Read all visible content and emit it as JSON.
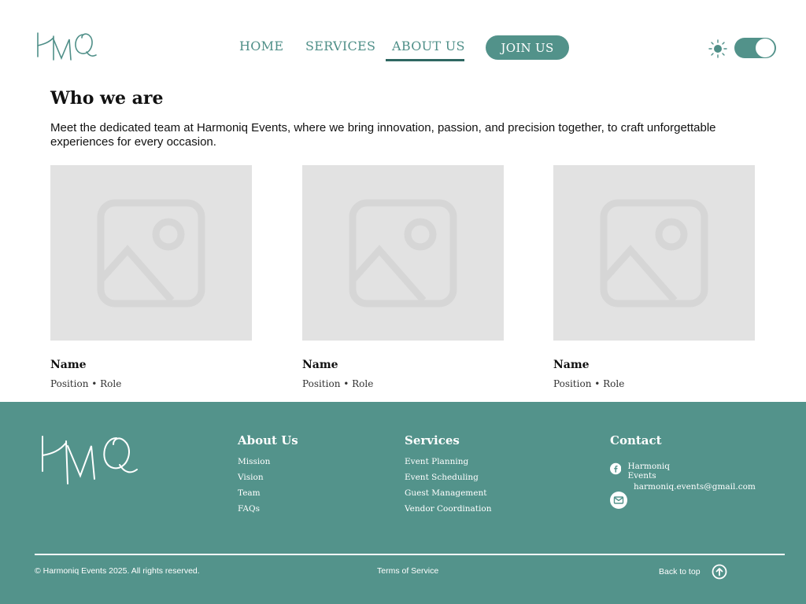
{
  "header": {
    "logo_text": "HMQ",
    "nav": {
      "home": "HOME",
      "services": "SERVICES",
      "about": "ABOUT US"
    },
    "join_label": "JOIN US",
    "theme_toggle": "on"
  },
  "main": {
    "title": "Who we are",
    "intro": "Meet the dedicated team at Harmoniq Events, where we bring innovation, passion, and precision together, to craft unforgettable experiences for every occasion.",
    "team": [
      {
        "name": "Name",
        "role": "Position • Role"
      },
      {
        "name": "Name",
        "role": "Position • Role"
      },
      {
        "name": "Name",
        "role": "Position • Role"
      }
    ]
  },
  "footer": {
    "about": {
      "heading": "About Us",
      "links": [
        "Mission",
        "Vision",
        "Team",
        "FAQs"
      ]
    },
    "services": {
      "heading": "Services",
      "links": [
        "Event Planning",
        "Event Scheduling",
        "Guest Management",
        "Vendor Coordination"
      ]
    },
    "contact": {
      "heading": "Contact",
      "facebook": "Harmoniq Events",
      "email": "harmoniq.events@gmail.com"
    },
    "copyright": "© Harmoniq Events 2025. All rights reserved.",
    "terms": "Terms of Service",
    "back_to_top": "Back to top"
  },
  "colors": {
    "accent": "#52928a",
    "accent_dark": "#2f6862",
    "placeholder": "#e2e2e2"
  }
}
